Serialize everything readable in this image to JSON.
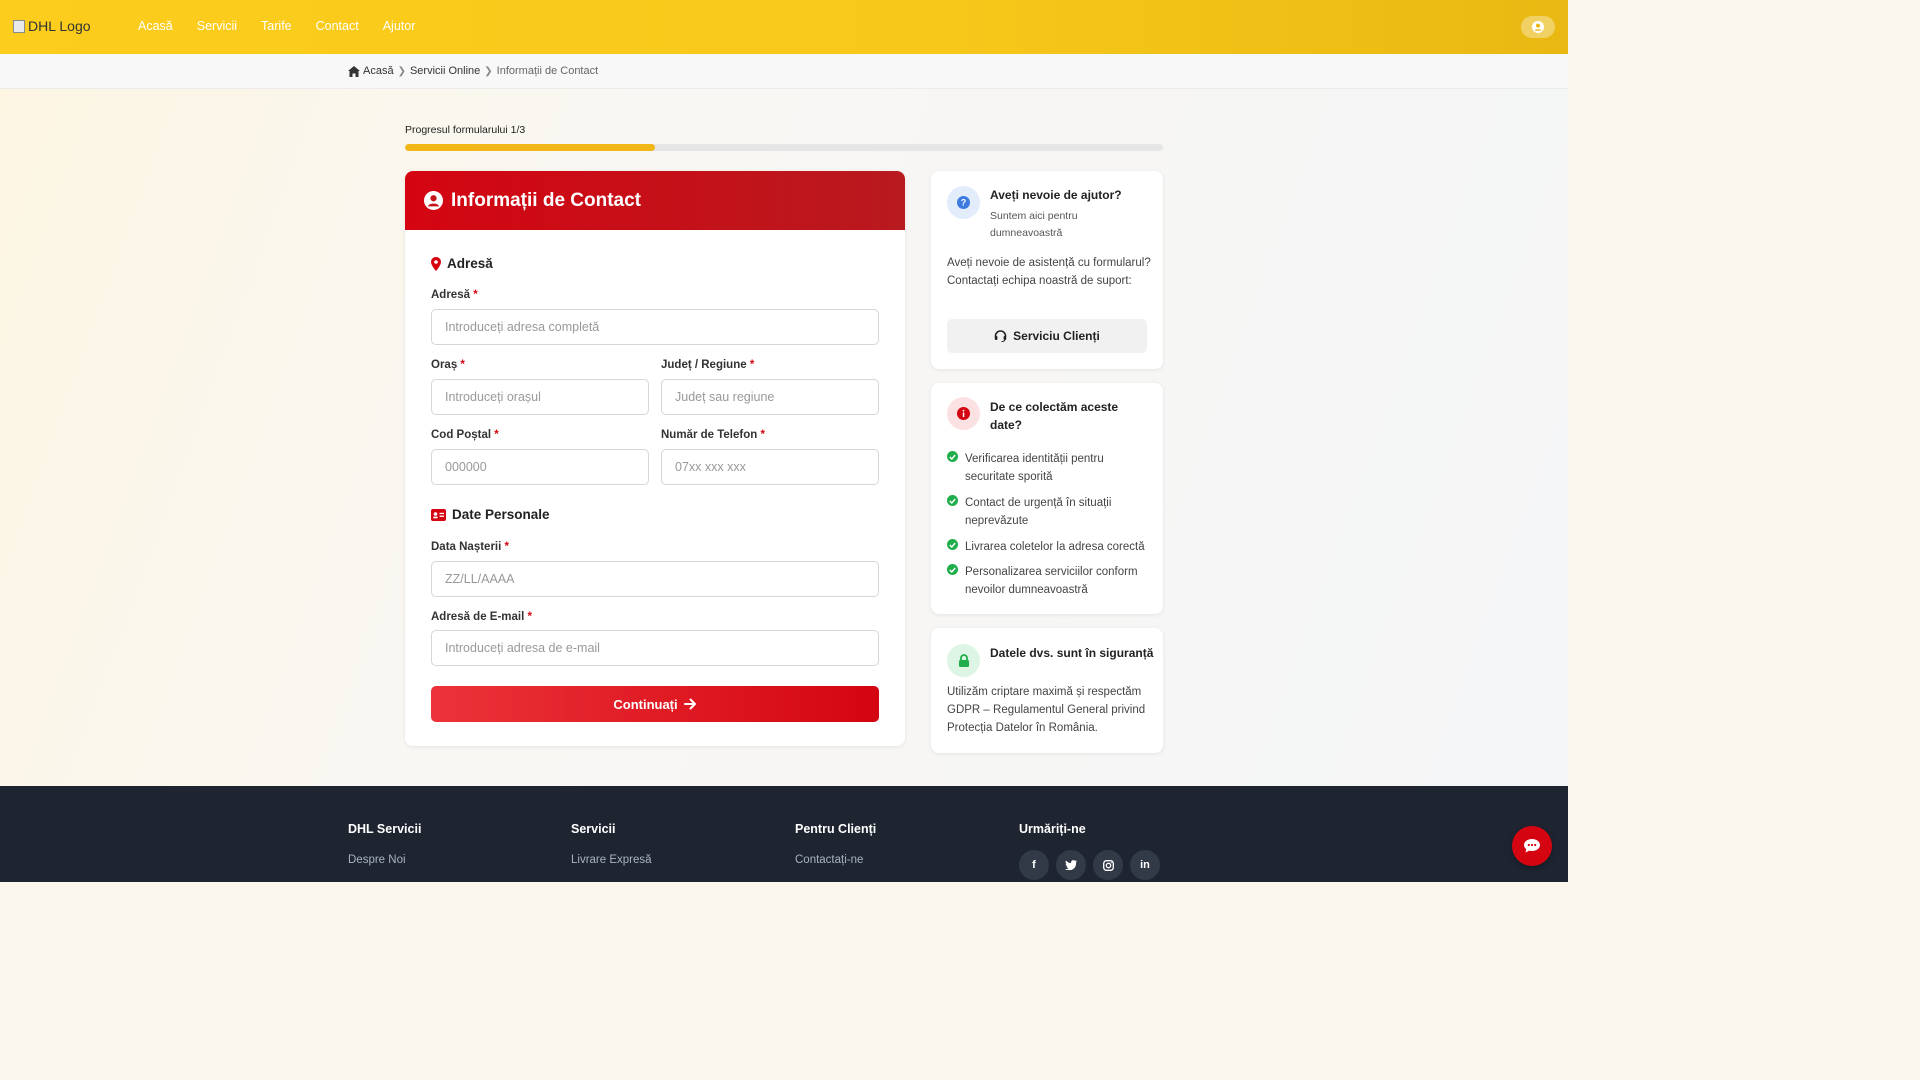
{
  "header": {
    "logo_alt": "DHL Logo",
    "nav": [
      "Acasă",
      "Servicii",
      "Tarife",
      "Contact",
      "Ajutor"
    ]
  },
  "breadcrumb": [
    "Acasă",
    "Servicii Online",
    "Informații de Contact"
  ],
  "progress": {
    "label": "Progresul formularului 1/3",
    "fraction": 0.33
  },
  "form": {
    "title": "Informații de Contact",
    "section_address": "Adresă",
    "section_personal": "Date Personale",
    "fields": {
      "address": {
        "label": "Adresă",
        "placeholder": "Introduceți adresa completă"
      },
      "city": {
        "label": "Oraș",
        "placeholder": "Introduceți orașul"
      },
      "county": {
        "label": "Județ / Regiune",
        "placeholder": "Județ sau regiune"
      },
      "postal": {
        "label": "Cod Poștal",
        "placeholder": "000000"
      },
      "phone": {
        "label": "Număr de Telefon",
        "placeholder": "07xx xxx xxx"
      },
      "birth": {
        "label": "Data Nașterii",
        "placeholder": "ZZ/LL/AAAA"
      },
      "email": {
        "label": "Adresă de E-mail",
        "placeholder": "Introduceți adresa de e-mail"
      }
    },
    "required_mark": "*",
    "continue_label": "Continuați"
  },
  "help": {
    "title": "Aveți nevoie de ajutor?",
    "subtitle_l1": "Suntem aici pentru",
    "subtitle_l2": "dumneavoastră",
    "text": "Aveți nevoie de asistență cu formularul? Contactați echipa noastră de suport:",
    "button": "Serviciu Clienți"
  },
  "why": {
    "title_l1": "De ce colectăm aceste",
    "title_l2": "date?",
    "reasons": [
      "Verificarea identității pentru securitate sporită",
      "Contact de urgență în situații neprevăzute",
      "Livrarea coletelor la adresa corectă",
      "Personalizarea serviciilor conform nevoilor dumneavoastră"
    ]
  },
  "safe": {
    "title": "Datele dvs. sunt în siguranță",
    "text": "Utilizăm criptare maximă și respectăm GDPR – Regulamentul General privind Protecția Datelor în România."
  },
  "footer": {
    "cols": [
      {
        "title": "DHL Servicii",
        "link": "Despre Noi"
      },
      {
        "title": "Servicii",
        "link": "Livrare Expresă"
      },
      {
        "title": "Pentru Clienți",
        "link": "Contactați-ne"
      },
      {
        "title": "Urmăriți-ne"
      }
    ],
    "socials": [
      "facebook-icon",
      "twitter-icon",
      "instagram-icon",
      "linkedin-icon"
    ]
  },
  "colors": {
    "brand_yellow": "#fccd1c",
    "brand_red": "#d40511",
    "footer_bg": "#1e2531"
  }
}
